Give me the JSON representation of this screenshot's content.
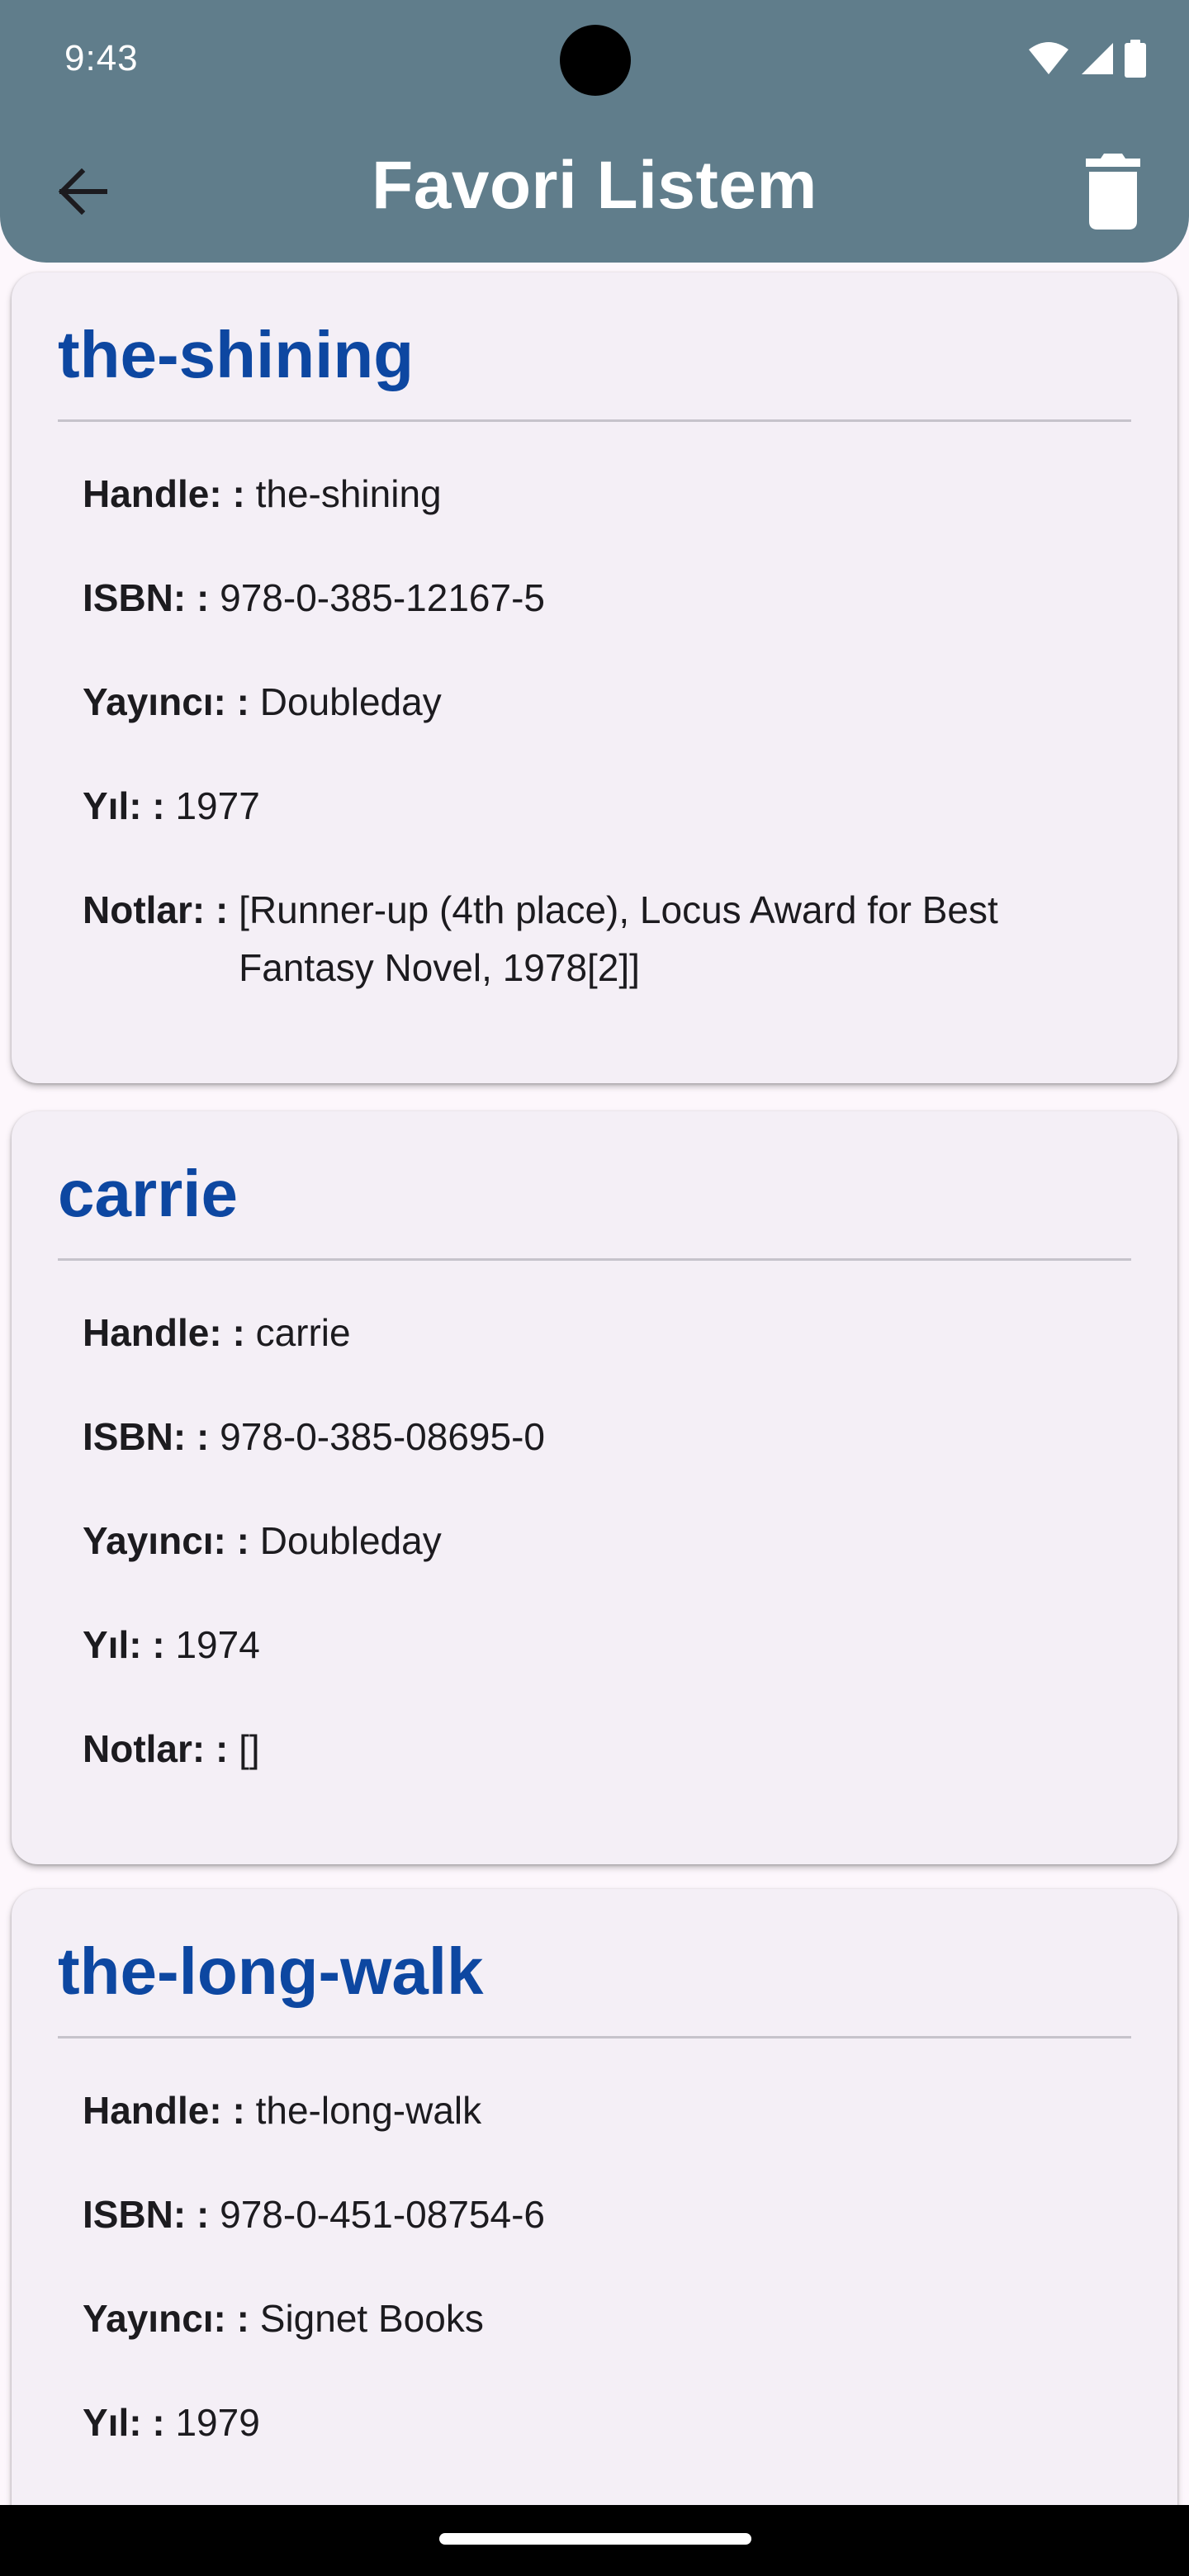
{
  "status_bar": {
    "time": "9:43",
    "icons": [
      "wifi-icon",
      "signal-icon",
      "battery-icon"
    ]
  },
  "app_bar": {
    "title": "Favori Listem",
    "back_icon": "arrow-back-icon",
    "delete_icon": "trash-icon",
    "color": "#607d8b"
  },
  "colors": {
    "card_title": "#0d47a1",
    "card_background": "#f4eff6",
    "page_background": "#fdf7fc"
  },
  "field_labels": {
    "handle": "Handle:",
    "isbn": "ISBN:",
    "publisher": "Yayıncı:",
    "year": "Yıl:",
    "notes": "Notlar:",
    "separator": " : "
  },
  "books": [
    {
      "title": "the-shining",
      "handle": "the-shining",
      "isbn": "978-0-385-12167-5",
      "publisher": "Doubleday",
      "year": "1977",
      "notes": "[Runner-up (4th place), Locus Award for Best Fantasy Novel, 1978[2]]"
    },
    {
      "title": "carrie",
      "handle": "carrie",
      "isbn": "978-0-385-08695-0",
      "publisher": "Doubleday",
      "year": "1974",
      "notes": "[]"
    },
    {
      "title": "the-long-walk",
      "handle": "the-long-walk",
      "isbn": "978-0-451-08754-6",
      "publisher": "Signet Books",
      "year": "1979"
    }
  ]
}
